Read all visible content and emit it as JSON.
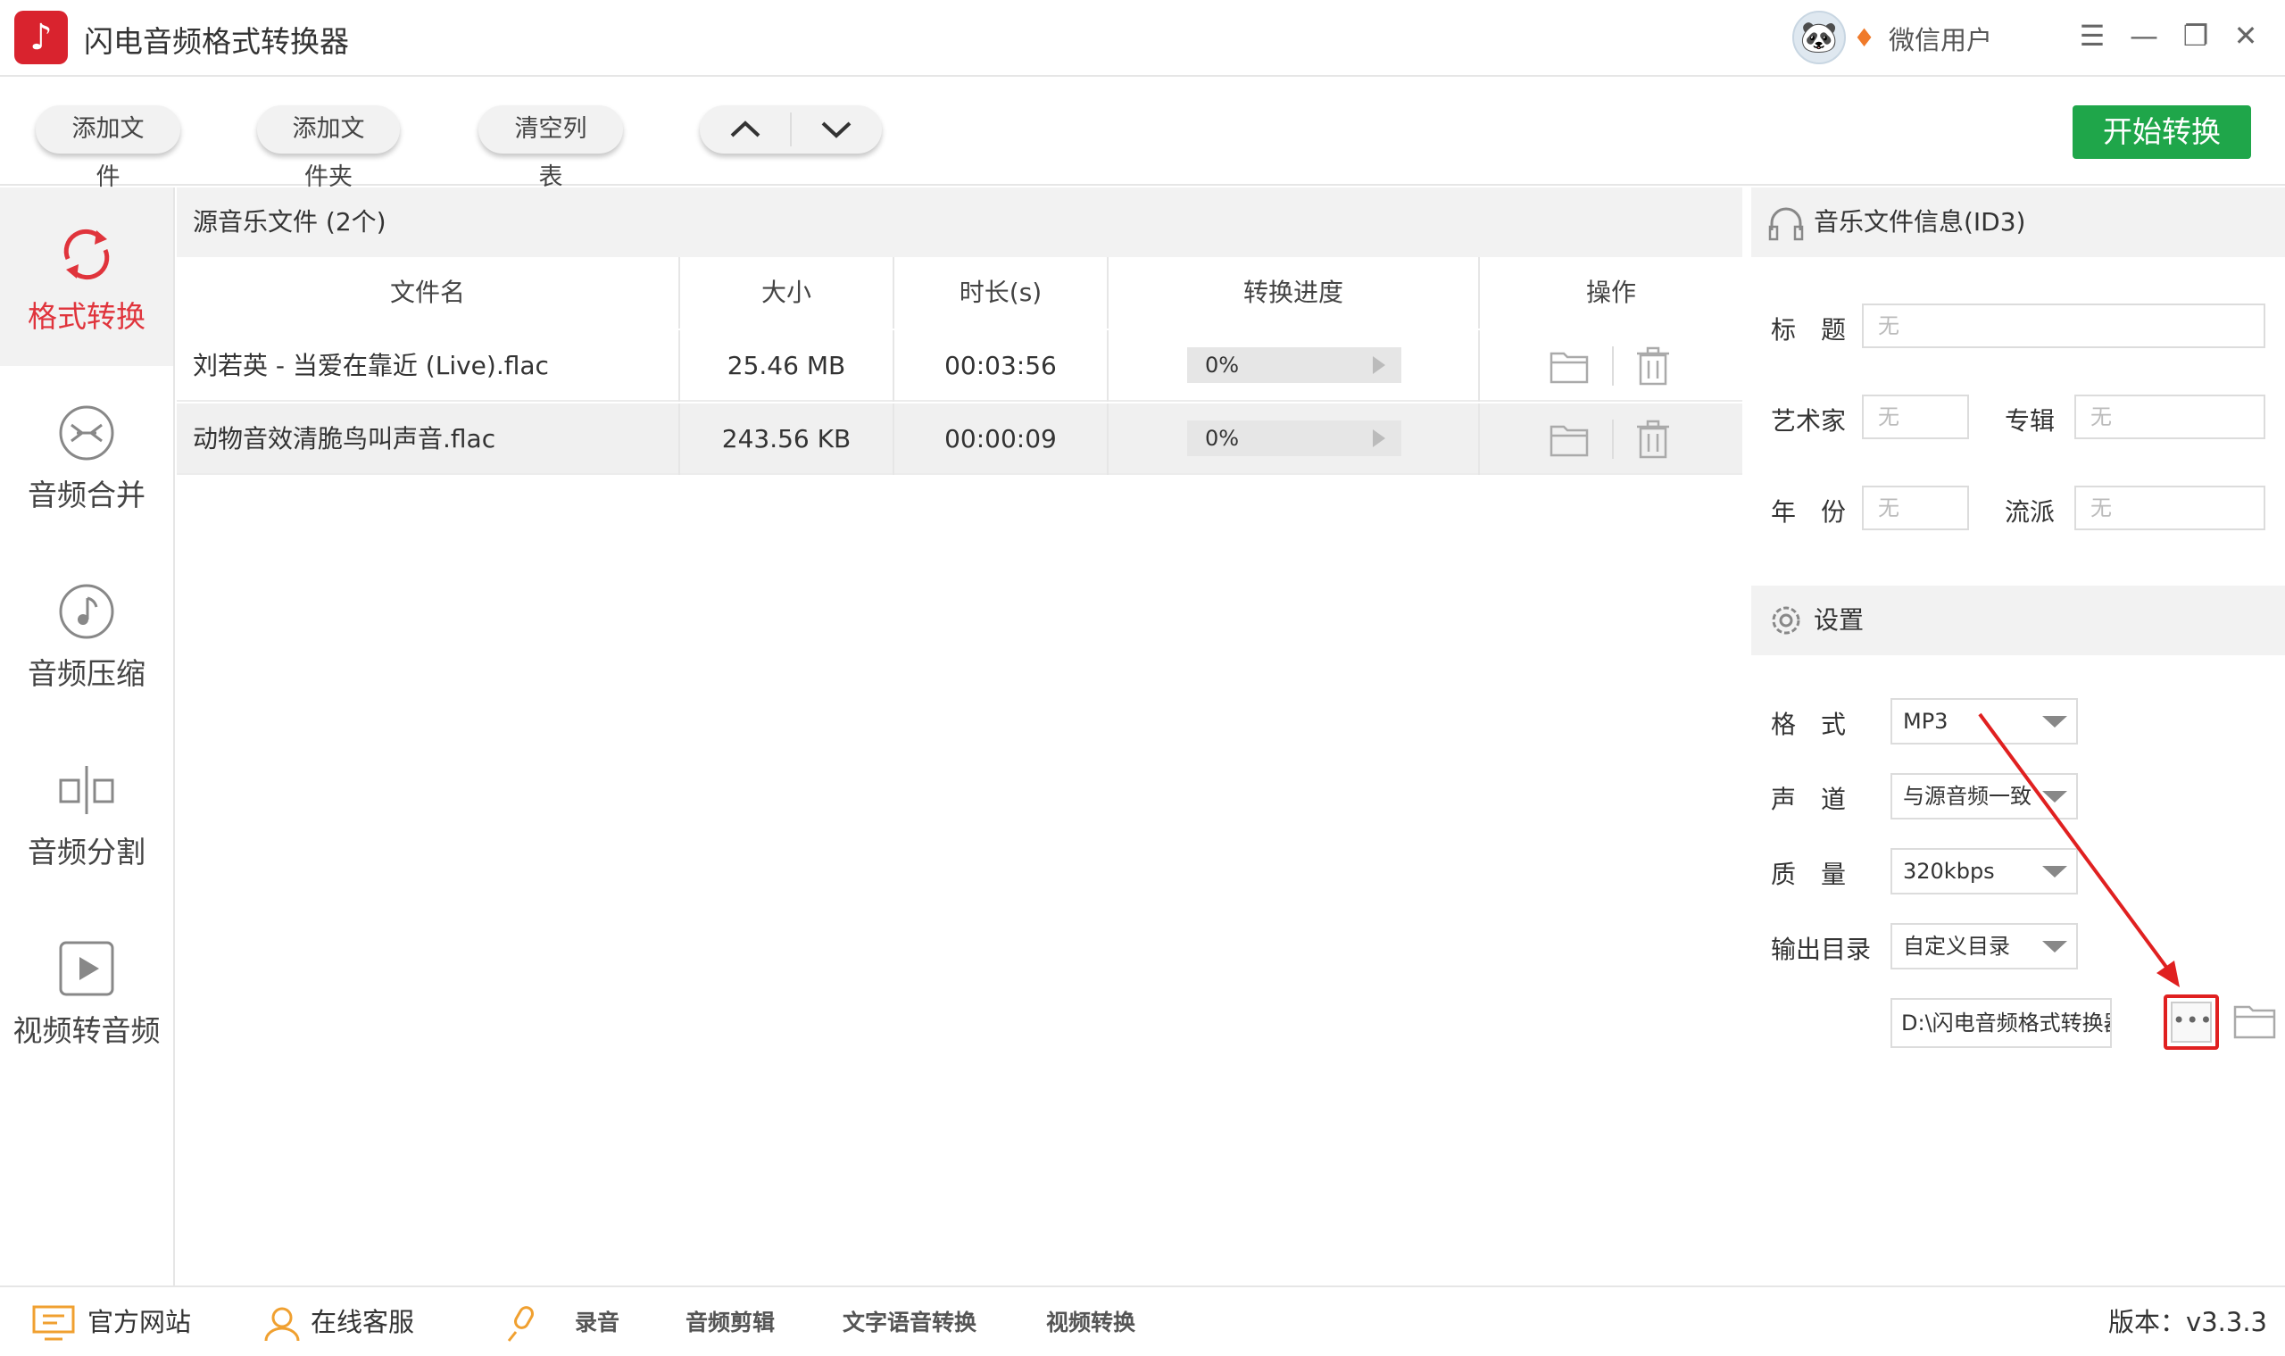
{
  "app": {
    "title": "闪电音频格式转换器",
    "user": "微信用户"
  },
  "toolbar": {
    "add_file": "添加文件",
    "add_folder": "添加文件夹",
    "clear_list": "清空列表",
    "start": "开始转换"
  },
  "nav": [
    {
      "label": "格式转换",
      "icon": "convert-icon",
      "active": true
    },
    {
      "label": "音频合并",
      "icon": "merge-icon"
    },
    {
      "label": "音频压缩",
      "icon": "compress-icon"
    },
    {
      "label": "音频分割",
      "icon": "split-icon"
    },
    {
      "label": "视频转音频",
      "icon": "video-icon"
    }
  ],
  "filelist": {
    "header": "源音乐文件 (2个)",
    "columns": [
      "文件名",
      "大小",
      "时长(s)",
      "转换进度",
      "操作"
    ],
    "rows": [
      {
        "name": "刘若英 - 当爱在靠近 (Live).flac",
        "size": "25.46 MB",
        "duration": "00:03:56",
        "progress": "0%"
      },
      {
        "name": "动物音效清脆鸟叫声音.flac",
        "size": "243.56 KB",
        "duration": "00:00:09",
        "progress": "0%"
      }
    ]
  },
  "id3": {
    "header": "音乐文件信息(ID3)",
    "title_label": "标　题",
    "artist_label": "艺术家",
    "album_label": "专辑",
    "year_label": "年　份",
    "genre_label": "流派",
    "placeholder": "无"
  },
  "settings": {
    "header": "设置",
    "format_label": "格　式",
    "format_value": "MP3",
    "channel_label": "声　道",
    "channel_value": "与源音频一致",
    "quality_label": "质　量",
    "quality_value": "320kbps",
    "output_label": "输出目录",
    "output_value": "自定义目录",
    "path": "D:\\闪电音频格式转换器\\",
    "more": "•••"
  },
  "bottom": {
    "website": "官方网站",
    "service": "在线客服",
    "record": "录音",
    "edit": "音频剪辑",
    "tts": "文字语音转换",
    "video": "视频转换",
    "version": "版本：v3.3.3"
  },
  "colors": {
    "accent": "#e0343c",
    "start_button": "#1fa64a",
    "highlight_box": "#e02020"
  }
}
